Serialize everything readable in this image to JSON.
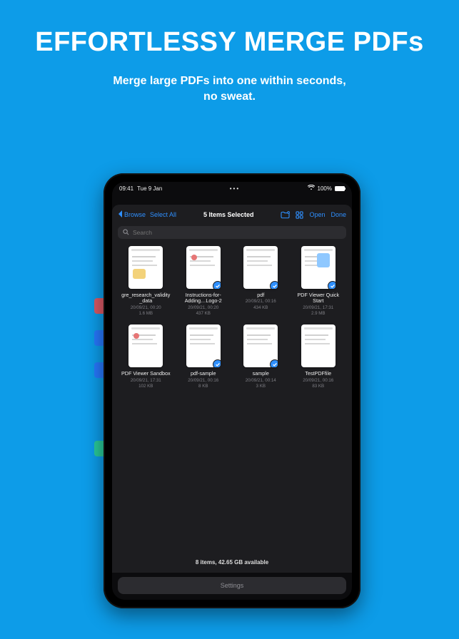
{
  "hero": {
    "title": "EFFORTLESSY MERGE PDFs",
    "subtitle_l1": "Merge large PDFs into one within seconds,",
    "subtitle_l2": "no sweat."
  },
  "status": {
    "time": "09:41",
    "date": "Tue 9 Jan",
    "battery_pct": "100%"
  },
  "toolbar": {
    "back": "Browse",
    "select_all": "Select All",
    "title": "5 Items Selected",
    "open": "Open",
    "done": "Done"
  },
  "search": {
    "placeholder": "Search"
  },
  "files": [
    {
      "name": "gre_research_validity_data",
      "date": "20/09/21, 00:20",
      "size": "1.6 MB",
      "selected": false,
      "variant": "a"
    },
    {
      "name": "Instructions-for-Adding…Logo-2",
      "date": "20/09/21, 00:20",
      "size": "437 KB",
      "selected": true,
      "variant": "c"
    },
    {
      "name": "pdf",
      "date": "20/09/21, 00:16",
      "size": "434 KB",
      "selected": true,
      "variant": "d"
    },
    {
      "name": "PDF Viewer Quick Start",
      "date": "20/09/21, 17:31",
      "size": "2.9 MB",
      "selected": true,
      "variant": "b"
    },
    {
      "name": "PDF Viewer Sandbox",
      "date": "20/09/21, 17:31",
      "size": "102 KB",
      "selected": false,
      "variant": "c"
    },
    {
      "name": "pdf-sample",
      "date": "20/09/21, 00:16",
      "size": "8 KB",
      "selected": true,
      "variant": "d"
    },
    {
      "name": "sample",
      "date": "20/09/21, 00:14",
      "size": "3 KB",
      "selected": true,
      "variant": "d"
    },
    {
      "name": "TestPDFfile",
      "date": "20/09/21, 00:16",
      "size": "83 KB",
      "selected": false,
      "variant": "d"
    }
  ],
  "footer": {
    "availability": "8 items, 42.65 GB available"
  },
  "settings": {
    "label": "Settings"
  }
}
